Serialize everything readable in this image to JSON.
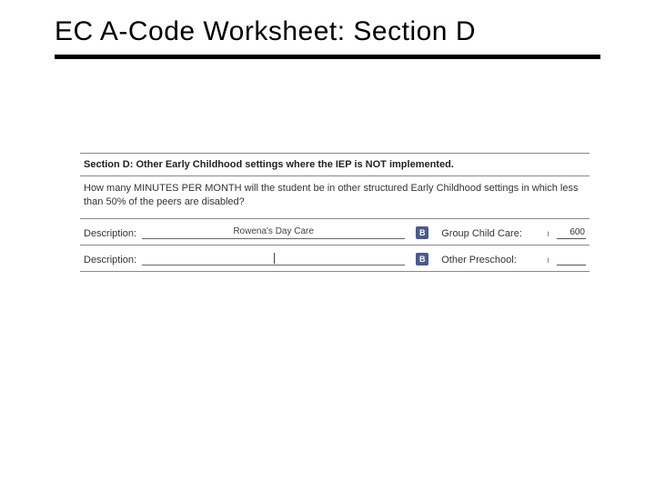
{
  "title": "EC A-Code Worksheet:  Section D",
  "section": {
    "header": "Section D: Other Early Childhood settings where the IEP is NOT implemented.",
    "instructions": "How many MINUTES PER MONTH will the student be in other structured Early Childhood settings in which less than 50% of the peers are disabled?",
    "rows": [
      {
        "label": "Description:",
        "value": "Rowena's Day Care",
        "chip": "B",
        "category": "Group Child Care:",
        "minutes": "600"
      },
      {
        "label": "Description:",
        "value": "",
        "chip": "B",
        "category": "Other Preschool:",
        "minutes": ""
      }
    ]
  }
}
